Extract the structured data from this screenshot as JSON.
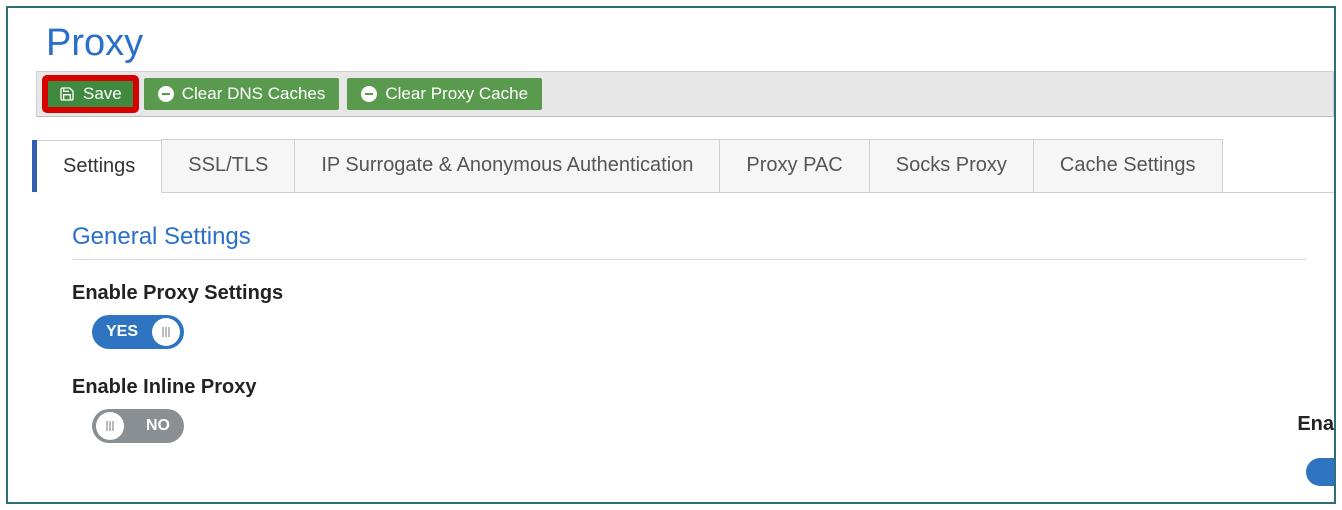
{
  "page": {
    "title": "Proxy"
  },
  "toolbar": {
    "save_label": "Save",
    "clear_dns_label": "Clear DNS Caches",
    "clear_proxy_label": "Clear Proxy Cache"
  },
  "tabs": {
    "t0": "Settings",
    "t1": "SSL/TLS",
    "t2": "IP Surrogate & Anonymous Authentication",
    "t3": "Proxy PAC",
    "t4": "Socks Proxy",
    "t5": "Cache Settings"
  },
  "section": {
    "general_title": "General Settings"
  },
  "fields": {
    "enable_proxy": {
      "label": "Enable Proxy Settings",
      "value": "YES"
    },
    "enable_inline": {
      "label": "Enable Inline Proxy",
      "value": "NO"
    }
  },
  "cutoff": {
    "label": "Ena"
  }
}
